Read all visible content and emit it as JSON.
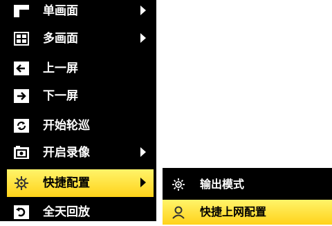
{
  "menu": {
    "items": [
      {
        "label": "单画面",
        "icon": "single-screen-icon",
        "has_submenu": true
      },
      {
        "label": "多画面",
        "icon": "multi-screen-icon",
        "has_submenu": true
      },
      {
        "label": "上一屏",
        "icon": "arrow-left-icon",
        "has_submenu": false
      },
      {
        "label": "下一屏",
        "icon": "arrow-right-icon",
        "has_submenu": false
      },
      {
        "label": "开始轮巡",
        "icon": "cycle-icon",
        "has_submenu": false
      },
      {
        "label": "开启录像",
        "icon": "record-icon",
        "has_submenu": true
      },
      {
        "label": "快捷配置",
        "icon": "settings-icon",
        "has_submenu": true,
        "selected": true
      },
      {
        "label": "全天回放",
        "icon": "playback-icon",
        "has_submenu": false
      }
    ]
  },
  "submenu": {
    "items": [
      {
        "label": "输出模式",
        "icon": "output-mode-icon"
      },
      {
        "label": "快捷上网配置",
        "icon": "network-user-icon",
        "selected": true
      }
    ]
  },
  "colors": {
    "menu_background": "#000000",
    "highlight": "#ffe03a",
    "text": "#ffffff",
    "selected_text": "#000000"
  }
}
